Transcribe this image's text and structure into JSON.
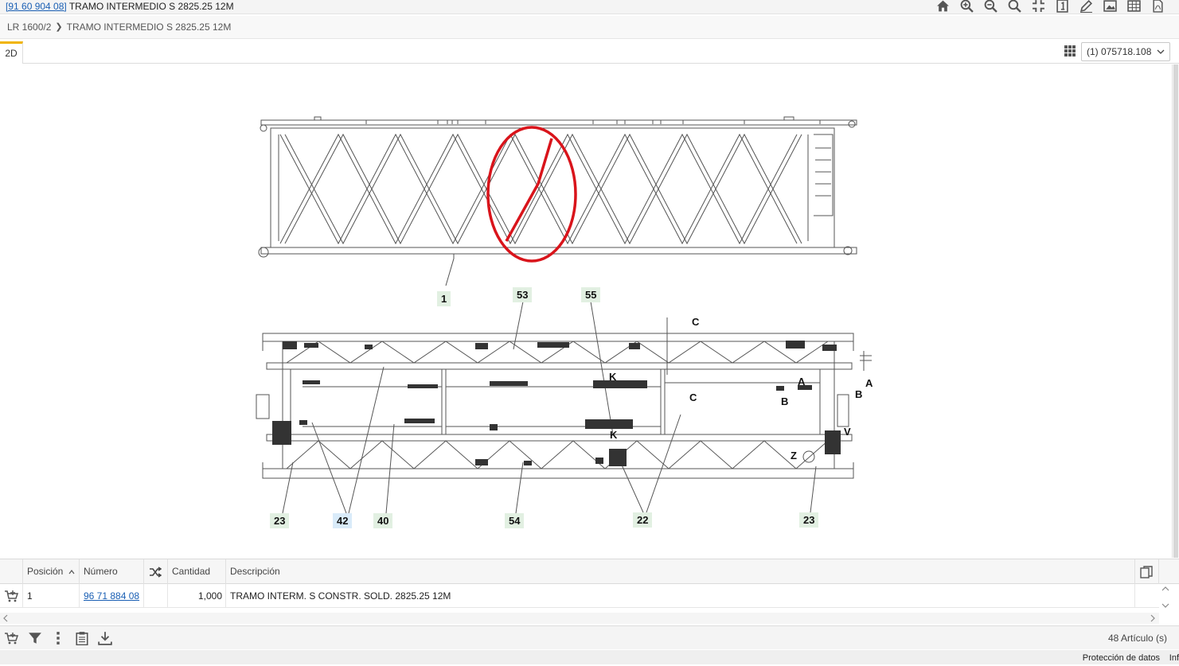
{
  "window": {
    "part_link": "[91 60 904 08]",
    "title": " TRAMO INTERMEDIO S 2825.25 12M"
  },
  "toolbar_icons": [
    "home-icon",
    "zoom-in-icon",
    "zoom-out-icon",
    "search-icon",
    "fit-view-icon",
    "info-icon",
    "pen-icon",
    "image-icon",
    "table-icon",
    "pdf-icon"
  ],
  "breadcrumb": {
    "root": "LR 1600/2",
    "current": "TRAMO INTERMEDIO S 2825.25 12M"
  },
  "tabs": {
    "view_2d": "2D"
  },
  "sheet_selector": {
    "value": "(1) 075718.108"
  },
  "drawing": {
    "callouts": {
      "c1": "1",
      "c53": "53",
      "c55": "55",
      "c23a": "23",
      "c42": "42",
      "c40": "40",
      "c54": "54",
      "c22": "22",
      "c23b": "23"
    },
    "letters": [
      "C",
      "C",
      "K",
      "K",
      "A",
      "A",
      "B",
      "B",
      "V",
      "Z"
    ],
    "accent_red": "#d9141b"
  },
  "table": {
    "headers": {
      "position": "Posición",
      "number": "Número",
      "quantity": "Cantidad",
      "description": "Descripción"
    },
    "rows": [
      {
        "position": "1",
        "number": "96 71 884 08",
        "quantity": "1,000",
        "description": "TRAMO INTERM. S CONSTR. SOLD. 2825.25 12M"
      }
    ]
  },
  "footer": {
    "count": "48 Artículo (s)"
  },
  "status": {
    "privacy": "Protección de datos",
    "info": "Inf"
  }
}
